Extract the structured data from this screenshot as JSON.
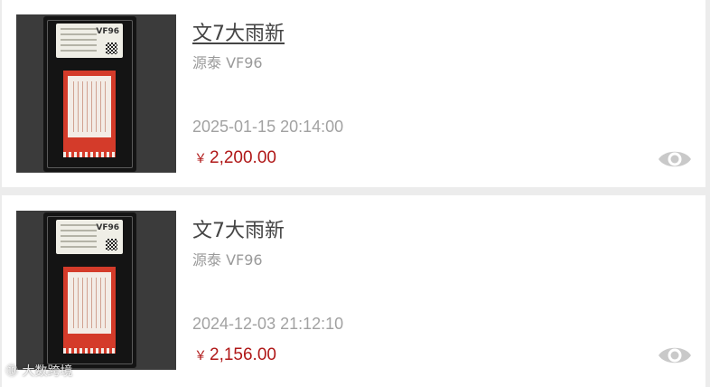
{
  "listings": [
    {
      "title": "文7大雨新",
      "seller": "源泰 VF96",
      "time": "2025-01-15 20:14:00",
      "currency": "￥",
      "price": "2,200.00",
      "grade_label": "VF96"
    },
    {
      "title": "文7大雨新",
      "seller": "源泰 VF96",
      "time": "2024-12-03 21:12:10",
      "currency": "￥",
      "price": "2,156.00",
      "grade_label": "VF96"
    }
  ],
  "colors": {
    "price": "#b01818",
    "meta": "#a2a2a2",
    "background": "#ececec"
  },
  "icons": {
    "view": "eye-icon"
  },
  "watermark": "大数跨境"
}
